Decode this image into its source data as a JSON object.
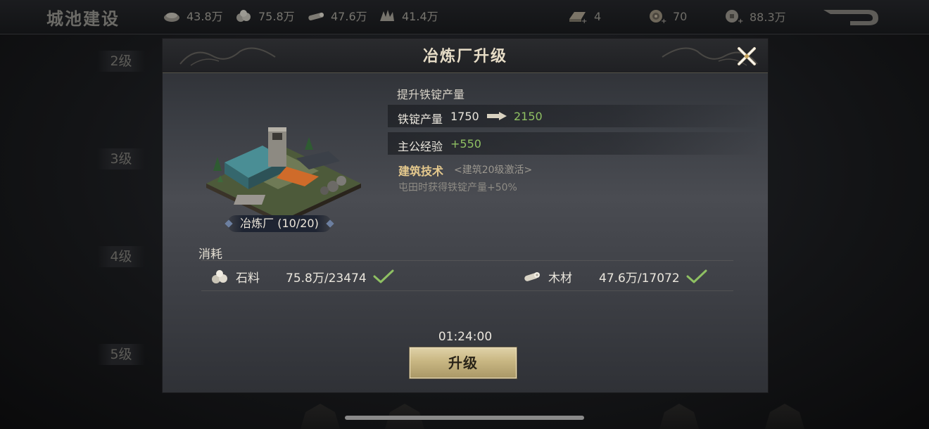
{
  "topbar": {
    "title": "城池建设",
    "resources": [
      {
        "icon": "grain-icon",
        "value": "43.8万"
      },
      {
        "icon": "stone-icon",
        "value": "75.8万"
      },
      {
        "icon": "wood-icon",
        "value": "47.6万"
      },
      {
        "icon": "iron-icon",
        "value": "41.4万"
      }
    ],
    "currencies": [
      {
        "icon": "gold-bar-icon",
        "value": "4"
      },
      {
        "icon": "coin-icon",
        "value": "70"
      },
      {
        "icon": "copper-coin-icon",
        "value": "88.3万"
      }
    ]
  },
  "levels": [
    "2级",
    "3级",
    "4级",
    "5级"
  ],
  "dialog": {
    "title": "冶炼厂升级",
    "building_name": "冶炼厂 (10/20)",
    "effect_heading": "提升铁锭产量",
    "output": {
      "label": "铁锭产量",
      "current": "1750",
      "next": "2150"
    },
    "exp": {
      "label": "主公经验",
      "value": "+550"
    },
    "tech": {
      "label": "建筑技术",
      "condition": "<建筑20级激活>",
      "description": "屯田时获得铁锭产量+50%"
    },
    "cost": {
      "title": "消耗",
      "items": [
        {
          "icon": "stone-icon",
          "name": "石料",
          "amount": "75.8万/23474",
          "satisfied": true
        },
        {
          "icon": "wood-icon",
          "name": "木材",
          "amount": "47.6万/17072",
          "satisfied": true
        }
      ]
    },
    "timer": "01:24:00",
    "upgrade_label": "升级"
  },
  "colors": {
    "accent_green": "#8fc063",
    "gold": "#c8b682",
    "tech_gold": "#e5c98d"
  }
}
